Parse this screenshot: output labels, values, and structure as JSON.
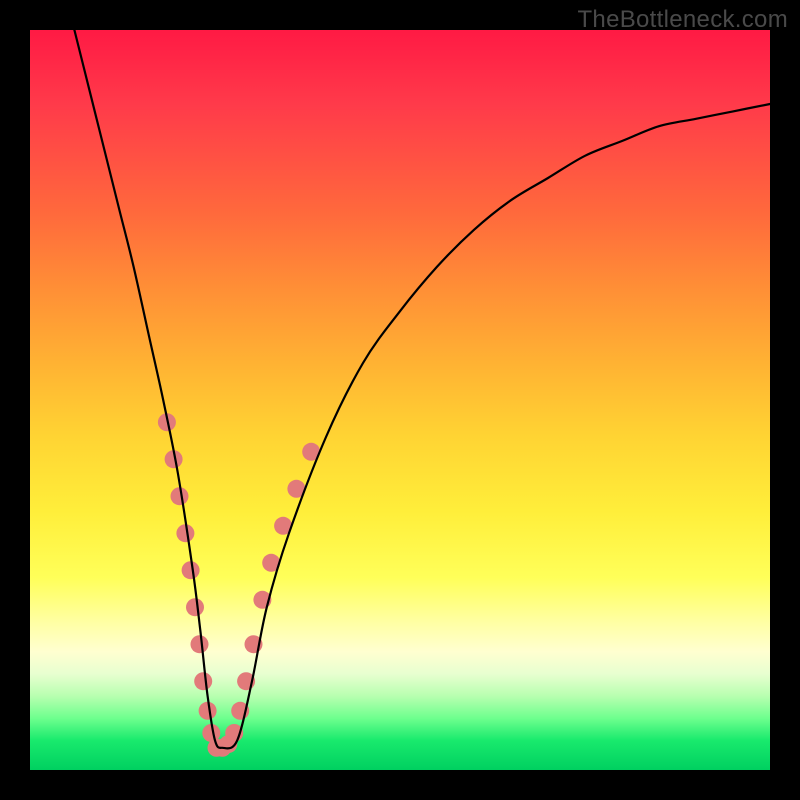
{
  "watermark": "TheBottleneck.com",
  "chart_data": {
    "type": "line",
    "title": "",
    "xlabel": "",
    "ylabel": "",
    "xlim": [
      0,
      100
    ],
    "ylim": [
      0,
      100
    ],
    "grid": false,
    "series": [
      {
        "name": "curve",
        "color": "#000000",
        "x": [
          6,
          8,
          10,
          12,
          14,
          16,
          18,
          20,
          22,
          23,
          24,
          25,
          26,
          28,
          30,
          32,
          35,
          40,
          45,
          50,
          55,
          60,
          65,
          70,
          75,
          80,
          85,
          90,
          95,
          100
        ],
        "y": [
          100,
          92,
          84,
          76,
          68,
          59,
          50,
          40,
          27,
          19,
          10,
          4,
          3,
          4,
          12,
          22,
          32,
          45,
          55,
          62,
          68,
          73,
          77,
          80,
          83,
          85,
          87,
          88,
          89,
          90
        ]
      }
    ],
    "highlight_points": {
      "name": "dots",
      "color": "#e27a7a",
      "radius_px": 9,
      "points": [
        {
          "x": 18.5,
          "y": 47
        },
        {
          "x": 19.4,
          "y": 42
        },
        {
          "x": 20.2,
          "y": 37
        },
        {
          "x": 21.0,
          "y": 32
        },
        {
          "x": 21.7,
          "y": 27
        },
        {
          "x": 22.3,
          "y": 22
        },
        {
          "x": 22.9,
          "y": 17
        },
        {
          "x": 23.4,
          "y": 12
        },
        {
          "x": 24.0,
          "y": 8
        },
        {
          "x": 24.5,
          "y": 5
        },
        {
          "x": 25.2,
          "y": 3
        },
        {
          "x": 26.0,
          "y": 3
        },
        {
          "x": 26.8,
          "y": 3.5
        },
        {
          "x": 27.6,
          "y": 5
        },
        {
          "x": 28.4,
          "y": 8
        },
        {
          "x": 29.2,
          "y": 12
        },
        {
          "x": 30.2,
          "y": 17
        },
        {
          "x": 31.4,
          "y": 23
        },
        {
          "x": 32.6,
          "y": 28
        },
        {
          "x": 34.2,
          "y": 33
        },
        {
          "x": 36.0,
          "y": 38
        },
        {
          "x": 38.0,
          "y": 43
        }
      ]
    }
  }
}
